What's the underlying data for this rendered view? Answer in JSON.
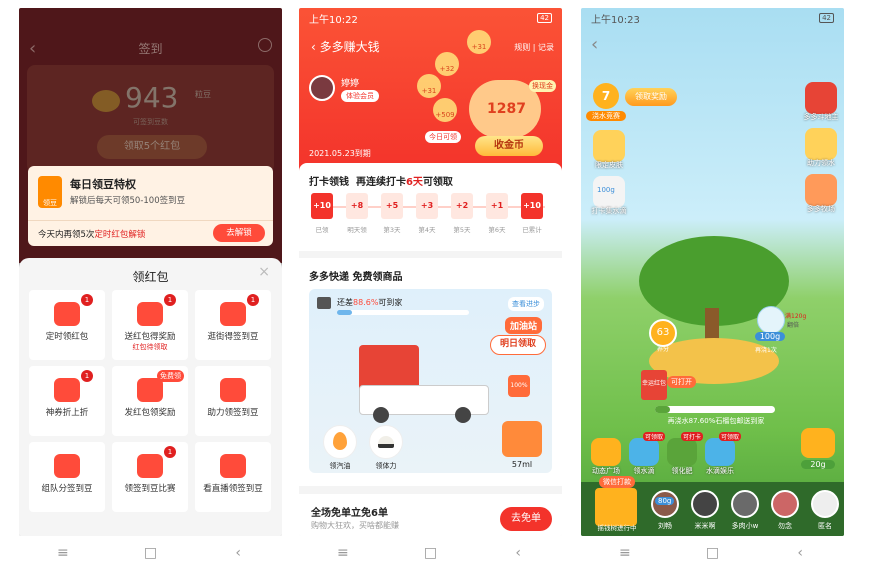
{
  "colors": {
    "accent": "#ff4b3a",
    "primary_red": "#e02020",
    "orange": "#ff8a00",
    "green": "#5aa43a"
  },
  "screen1": {
    "title": "签到",
    "points": "943",
    "points_unit": "粒豆",
    "sub": "可签到豆数",
    "claim_button": "领取5个红包",
    "daily": {
      "title": "每日领豆特权",
      "desc": "解锁后每天可领50-100签到豆",
      "icon_text": "领豆",
      "unlock_text": "今天内再领5次",
      "timer_text": "定时红包解锁",
      "button": "去解锁"
    },
    "sheet_title": "领红包",
    "close": "×",
    "items": [
      {
        "label": "定时领红包",
        "badge": "1",
        "sub": "",
        "icon": "clock-icon",
        "tag": ""
      },
      {
        "label": "送红包得奖励",
        "badge": "1",
        "sub": "红包待领取",
        "icon": "person-icon",
        "tag": ""
      },
      {
        "label": "逛街得签到豆",
        "badge": "1",
        "sub": "",
        "icon": "bag-icon",
        "tag": ""
      },
      {
        "label": "神券折上折",
        "badge": "1",
        "sub": "",
        "icon": "coupon-icon",
        "tag": ""
      },
      {
        "label": "发红包领奖励",
        "badge": "",
        "sub": "",
        "icon": "envelope-icon",
        "tag": "免费领"
      },
      {
        "label": "助力领签到豆",
        "badge": "",
        "sub": "",
        "icon": "hand-icon",
        "tag": ""
      },
      {
        "label": "组队分签到豆",
        "badge": "",
        "sub": "",
        "icon": "trophy-icon",
        "tag": ""
      },
      {
        "label": "领签到豆比赛",
        "badge": "1",
        "sub": "",
        "icon": "medal-icon",
        "tag": ""
      },
      {
        "label": "看直播领签到豆",
        "badge": "",
        "sub": "",
        "icon": "tv-icon",
        "tag": ""
      }
    ]
  },
  "screen2": {
    "time": "上午10:22",
    "battery": "42",
    "title": "多多赚大钱",
    "rules": "规则 | 记录",
    "user_name": "婷婷",
    "member": "体验会员",
    "expire": "2021.05.23到期",
    "bubbles": [
      "+32",
      "+31",
      "+31",
      "+509"
    ],
    "today": "今日可领",
    "coins": "1287",
    "swap": "换现金",
    "collect": "收金币",
    "checkin_title": "打卡领钱",
    "checkin_sub_a": "再连续打卡",
    "checkin_sub_days": "6天",
    "checkin_sub_b": "可领取",
    "days": [
      {
        "v": "+10",
        "l": "已领"
      },
      {
        "v": "+8",
        "l": "明天领"
      },
      {
        "v": "+5",
        "l": "第3天"
      },
      {
        "v": "+3",
        "l": "第4天"
      },
      {
        "v": "+2",
        "l": "第5天"
      },
      {
        "v": "+1",
        "l": "第6天"
      },
      {
        "v": "+10",
        "l": "已累计"
      }
    ],
    "express_title": "多多快递 免费领商品",
    "progress_a": "还差",
    "progress_pct": "88.6%",
    "progress_b": "可到家",
    "progress_value": 11.4,
    "view_progress": "查看进步",
    "station": "加油站",
    "tomorrow": "明日领取",
    "fuel_pct": "100%",
    "fuel_label": "领汽油",
    "energy_label": "领体力",
    "fuel_amount": "57ml",
    "free_title": "全场免单立免6单",
    "free_sub": "购物大狂欢，买啥都能赚",
    "free_button": "去免单"
  },
  "screen3": {
    "time": "上午10:23",
    "battery": "42",
    "level": "7",
    "level_label": "浇水竞赛",
    "reward": "领取奖励",
    "left_items": [
      "限定皮肤",
      "打卡集水滴"
    ],
    "water_amount": "100g",
    "right_items": [
      "多多斗地主",
      "助力领水",
      "多多牧场"
    ],
    "bubble_label": "满120g",
    "bubble_sub": "翻倍",
    "tree_water": "100g",
    "tree_water_sub": "再浇1次",
    "score": "63",
    "score_label": "养分",
    "redbag": "幸运红包",
    "open": "可打开",
    "status": "再浇水87.60%石榴包邮送到家",
    "tree_progress": 12.4,
    "bottom_icons": [
      {
        "label": "动态广场",
        "tag": ""
      },
      {
        "label": "领水滴",
        "tag": "可领取"
      },
      {
        "label": "领化肥",
        "tag": "可打卡"
      },
      {
        "label": "水滴娱乐",
        "tag": "可领取"
      }
    ],
    "kettle_amount": "20g",
    "wechat": "微信打款",
    "share_label": "摇钱树进行中",
    "friend_amount": "80g",
    "friends": [
      "刘畅",
      "米米啊",
      "多肉小w",
      "勿念",
      "匿名"
    ]
  },
  "nav": {
    "menu": "≡",
    "home": "□",
    "back": "‹"
  }
}
